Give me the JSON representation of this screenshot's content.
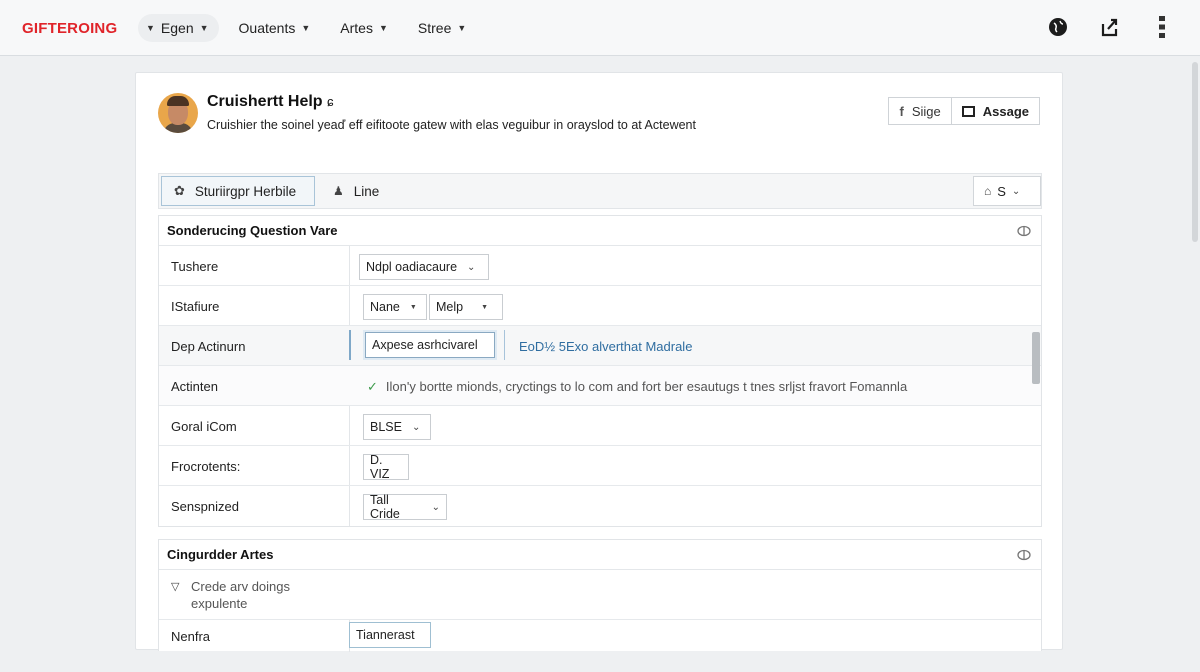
{
  "nav": {
    "brand": "GIFTEROING",
    "items": [
      {
        "label": "Egen"
      },
      {
        "label": "Ouatents"
      },
      {
        "label": "Artes"
      },
      {
        "label": "Stree"
      }
    ]
  },
  "profile": {
    "title": "Cruishertt Help",
    "title_suffix": "ɕ",
    "subtitle": "Cruishier the soinel yeaď eff eifitoote gatew with elas veguibur in orayslod to at Actewent"
  },
  "header_buttons": {
    "siige_label": "Siige",
    "assage_label": "Assage"
  },
  "toolbar": {
    "active_label": "Sturiirgpr Herbile",
    "line_label": "Line",
    "select_value": "S"
  },
  "section1": {
    "title": "Sonderucing Question Vare",
    "rows": [
      {
        "label": "Tushere",
        "control": "Ndpl oadiacaure"
      },
      {
        "label": "IStafiure",
        "control_a": "Nane",
        "control_b": "Melp"
      },
      {
        "label": "Dep Actinurn",
        "control": "Axpese asrhcivarel",
        "link": "EoD½ 5Exo alverthat Madrale"
      },
      {
        "label": "Actinten",
        "note": "Ilon'y bortte mionds, cryctings to lo com and fort ber esautugs t tnes srljst fravort Fomannla"
      },
      {
        "label": "Goral iCom",
        "control": "BLSE"
      },
      {
        "label": "Frocrotents:",
        "control": "D. VIZ"
      },
      {
        "label": "Senspnized",
        "control": "Tall Cride"
      }
    ]
  },
  "section2": {
    "title": "Cingurdder Artes",
    "expand_line1": "Crede arv doings",
    "expand_line2": "expulente",
    "row_label": "Nenfra",
    "row_control": "Tiannerast"
  }
}
